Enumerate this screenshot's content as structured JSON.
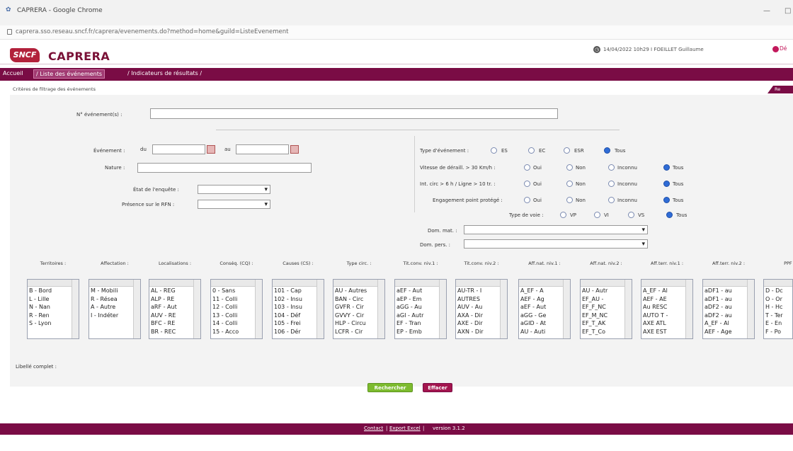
{
  "browser": {
    "title": "CAPRERA - Google Chrome",
    "url": "caprera.sso.reseau.sncf.fr/caprera/evenements.do?method=home&guild=ListeEvenement"
  },
  "header": {
    "logo_text": "SNCF",
    "app_title": "CAPRERA",
    "user_info": "14/04/2022 10h29 I FOEILLET Guillaume",
    "logout_label": "Dé"
  },
  "nav": {
    "home": "Accueil",
    "current": "/ Liste des événements",
    "indicators": "/ Indicateurs de résultats /"
  },
  "criteria_title": "Critères de filtrage des événements",
  "reset_tab": "Re",
  "form": {
    "event_num_label": "N° événement(s) :",
    "event_label": "Événement :",
    "du_label": "du",
    "au_label": "au",
    "nature_label": "Nature :",
    "enquete_label": "État de l'enquête :",
    "rfn_label": "Présence sur le RFN :",
    "type_evt_label": "Type d'événement :",
    "type_evt_options": [
      "ES",
      "EC",
      "ESR",
      "Tous"
    ],
    "vitesse_label": "Vitesse de déraill. > 30 Km/h :",
    "int_circ_label": "Int. circ > 6 h / Ligne > 10 tr. :",
    "engagement_label": "Engagement point protégé :",
    "oni_options": [
      "Oui",
      "Non",
      "Inconnu",
      "Tous"
    ],
    "type_voie_label": "Type de voie :",
    "type_voie_options": [
      "VP",
      "VI",
      "VS",
      "Tous"
    ],
    "dom_mat_label": "Dom. mat. :",
    "dom_pers_label": "Dom. pers. :",
    "libelle_label": "Libellé complet :"
  },
  "listboxes": [
    {
      "header": "Territoires :",
      "items": [
        "B - Bord",
        "L - Lille",
        "N - Nan",
        "R - Ren",
        "S - Lyon"
      ]
    },
    {
      "header": "Affectation :",
      "items": [
        "M - Mobili",
        "R - Résea",
        "A - Autre",
        "I - Indéter"
      ]
    },
    {
      "header": "Localisations :",
      "items": [
        "AL - REG",
        "ALP - RE",
        "aRF - Aut",
        "AUV - RE",
        "BFC - RE",
        "BR - REC"
      ]
    },
    {
      "header": "Conséq. (CQ) :",
      "items": [
        "0 - Sans",
        "11 - Colli",
        "12 - Colli",
        "13 - Colli",
        "14 - Colli",
        "15 - Acco"
      ]
    },
    {
      "header": "Causes (CS) :",
      "items": [
        "101 - Cap",
        "102 - Insu",
        "103 - Insu",
        "104 - Déf",
        "105 - Frei",
        "106 - Dér"
      ]
    },
    {
      "header": "Type circ. :",
      "items": [
        "AU - Autres",
        "BAN - Circ",
        "GVFR - Cir",
        "GVVY - Cir",
        "HLP - Circu",
        "LCFR - Cir"
      ]
    },
    {
      "header": "Tit.conv. niv.1 :",
      "items": [
        "aEF - Aut",
        "aEP - Em",
        "aGG - Au",
        "aGI - Autr",
        "EF - Tran",
        "EP - Emb"
      ]
    },
    {
      "header": "Tit.conv. niv.2 :",
      "items": [
        "AU-TR - I",
        "AUTRES",
        "AUV - Au",
        "AXA - Dir",
        "AXE - Dir",
        "AXN - Dir"
      ]
    },
    {
      "header": "Aff.nat. niv.1 :",
      "items": [
        "A_EF - A",
        "AEF - Ag",
        "aEF - Aut",
        "aGG - Ge",
        "aGID - At",
        "AU - Auti"
      ]
    },
    {
      "header": "Aff.nat. niv.2 :",
      "items": [
        "AU - Autr",
        "EF_AU -",
        "EF_F_NC",
        "EF_M_NC",
        "EF_T_AK",
        "EF_T_Co"
      ]
    },
    {
      "header": "Aff.terr. niv.1 :",
      "items": [
        "A_EF - Al",
        "AEF - AE",
        "Au RESC",
        "AUTO T -",
        "AXE ATL",
        "AXE EST"
      ]
    },
    {
      "header": "Aff.terr. niv.2 :",
      "items": [
        "aDF1 - au",
        "aDF1 - au",
        "aDF2 - au",
        "aDF2 - au",
        "A_EF - Al",
        "AEF - Age"
      ]
    },
    {
      "header": "PPF :",
      "items": [
        "D - Dc",
        "O - Or",
        "H - Hc",
        "T - Ter",
        "E - En",
        "F - Po"
      ]
    }
  ],
  "buttons": {
    "search": "Rechercher",
    "clear": "Effacer"
  },
  "footer": {
    "contact": "Contact",
    "export": "Export Excel",
    "version": "version 3.1.2"
  },
  "colors": {
    "brand": "#7a0c45",
    "logo": "#b2213b",
    "search_btn": "#7dbb2f",
    "clear_btn": "#a3154e"
  }
}
